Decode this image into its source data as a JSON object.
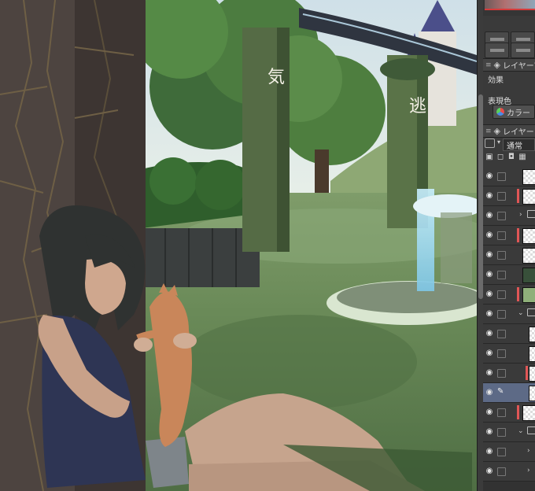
{
  "canvas": {
    "scene": "illustration-girl-with-cat-in-garden",
    "pillar_glyph_left": "気",
    "pillar_glyph_right": "逃"
  },
  "panel": {
    "layer_property_tab": "レイヤープロパティ",
    "effect_label": "効果",
    "expression_color_label": "表現色",
    "expression_color_value": "カラー",
    "layer_tab": "レイヤー",
    "blend_mode": "通常"
  },
  "colors": {
    "panel_bg": "#3a3a3a",
    "selected_layer": "#5d6a86",
    "layer_marker": "#e05656"
  },
  "icons": [
    "eye-icon",
    "lock-icon",
    "folder-icon",
    "pen-icon",
    "layers-icon",
    "chevron-right-icon",
    "chevron-down-icon"
  ]
}
